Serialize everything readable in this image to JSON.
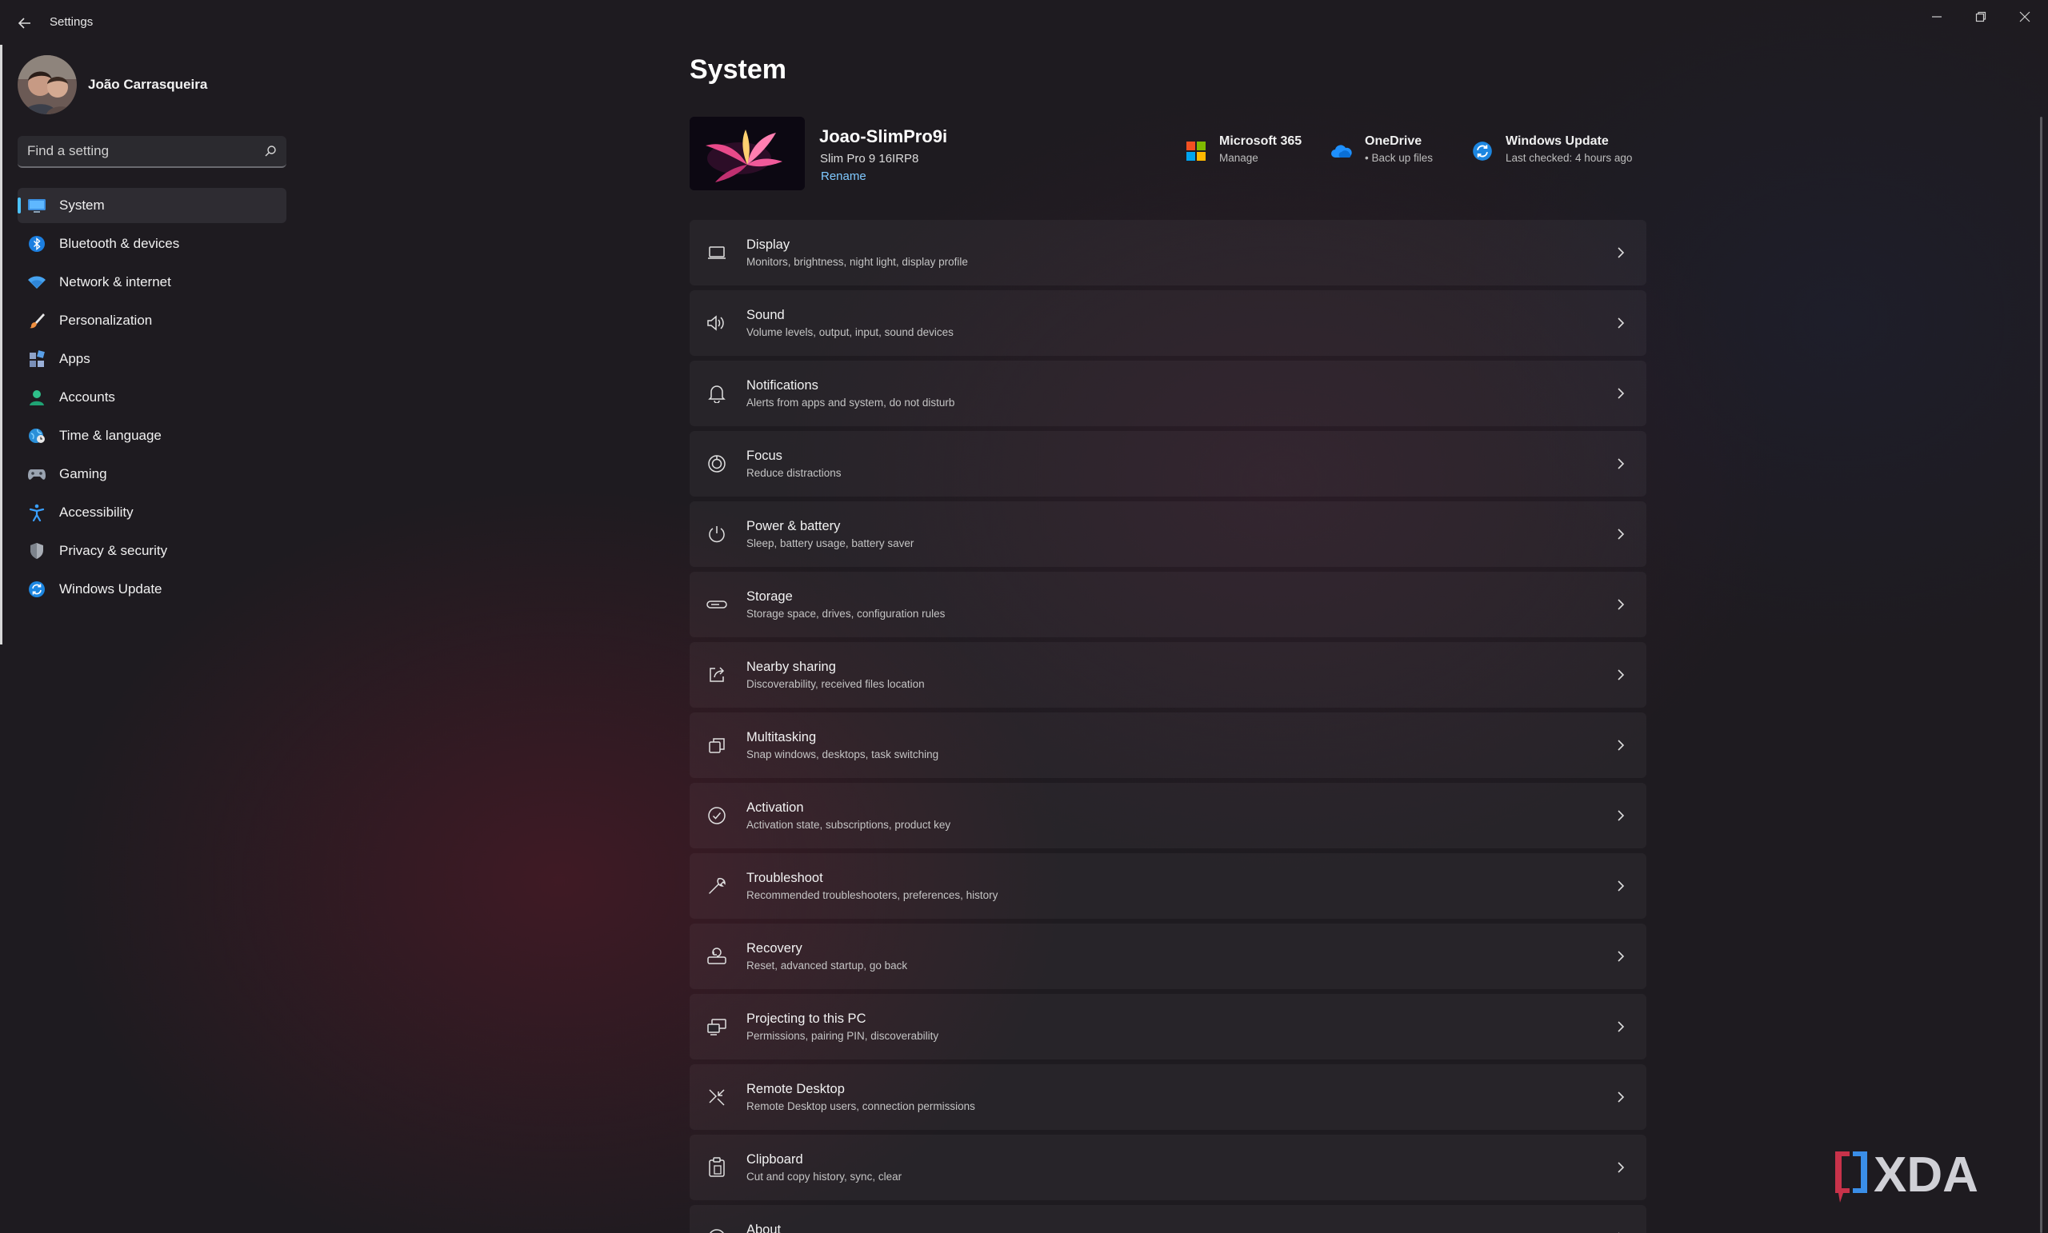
{
  "app": {
    "title": "Settings"
  },
  "user": {
    "name": "João Carrasqueira"
  },
  "search": {
    "placeholder": "Find a setting"
  },
  "sidebar": {
    "items": [
      {
        "label": "System",
        "icon": "monitor-icon",
        "active": true
      },
      {
        "label": "Bluetooth & devices",
        "icon": "bluetooth-icon"
      },
      {
        "label": "Network & internet",
        "icon": "wifi-icon"
      },
      {
        "label": "Personalization",
        "icon": "brush-icon"
      },
      {
        "label": "Apps",
        "icon": "apps-icon"
      },
      {
        "label": "Accounts",
        "icon": "person-icon"
      },
      {
        "label": "Time & language",
        "icon": "globe-clock-icon"
      },
      {
        "label": "Gaming",
        "icon": "gamepad-icon"
      },
      {
        "label": "Accessibility",
        "icon": "accessibility-icon"
      },
      {
        "label": "Privacy & security",
        "icon": "shield-icon"
      },
      {
        "label": "Windows Update",
        "icon": "update-icon"
      }
    ]
  },
  "page": {
    "title": "System"
  },
  "device": {
    "name": "Joao-SlimPro9i",
    "model": "Slim Pro 9 16IRP8",
    "rename": "Rename"
  },
  "quick": [
    {
      "title": "Microsoft 365",
      "sub": "Manage",
      "icon": "microsoft-logo-icon"
    },
    {
      "title": "OneDrive",
      "sub": "• Back up files",
      "icon": "onedrive-icon"
    },
    {
      "title": "Windows Update",
      "sub": "Last checked: 4 hours ago",
      "icon": "update-icon"
    }
  ],
  "rows": [
    {
      "title": "Display",
      "sub": "Monitors, brightness, night light, display profile",
      "icon": "display-icon"
    },
    {
      "title": "Sound",
      "sub": "Volume levels, output, input, sound devices",
      "icon": "speaker-icon"
    },
    {
      "title": "Notifications",
      "sub": "Alerts from apps and system, do not disturb",
      "icon": "bell-icon"
    },
    {
      "title": "Focus",
      "sub": "Reduce distractions",
      "icon": "focus-icon"
    },
    {
      "title": "Power & battery",
      "sub": "Sleep, battery usage, battery saver",
      "icon": "power-icon"
    },
    {
      "title": "Storage",
      "sub": "Storage space, drives, configuration rules",
      "icon": "storage-icon"
    },
    {
      "title": "Nearby sharing",
      "sub": "Discoverability, received files location",
      "icon": "share-icon"
    },
    {
      "title": "Multitasking",
      "sub": "Snap windows, desktops, task switching",
      "icon": "multitasking-icon"
    },
    {
      "title": "Activation",
      "sub": "Activation state, subscriptions, product key",
      "icon": "check-circle-icon"
    },
    {
      "title": "Troubleshoot",
      "sub": "Recommended troubleshooters, preferences, history",
      "icon": "wrench-icon"
    },
    {
      "title": "Recovery",
      "sub": "Reset, advanced startup, go back",
      "icon": "recovery-icon"
    },
    {
      "title": "Projecting to this PC",
      "sub": "Permissions, pairing PIN, discoverability",
      "icon": "projecting-icon"
    },
    {
      "title": "Remote Desktop",
      "sub": "Remote Desktop users, connection permissions",
      "icon": "remote-desktop-icon"
    },
    {
      "title": "Clipboard",
      "sub": "Cut and copy history, sync, clear",
      "icon": "clipboard-icon"
    },
    {
      "title": "About",
      "sub": "",
      "icon": "info-icon"
    }
  ],
  "watermark": {
    "text": "XDA"
  },
  "colors": {
    "accent": "#4cc2ff",
    "link": "#7fc9ff",
    "background": "#1e1b20"
  }
}
